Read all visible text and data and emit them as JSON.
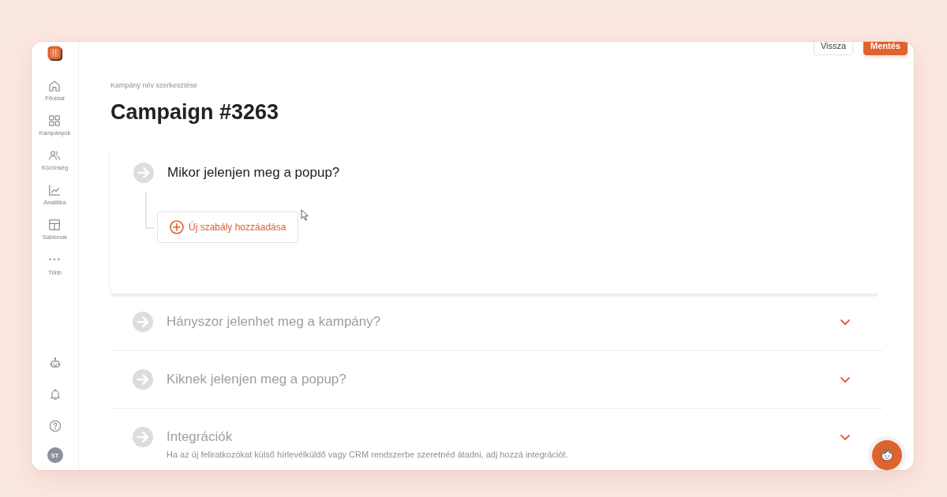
{
  "sidebar": {
    "items": [
      {
        "label": "Főoldal"
      },
      {
        "label": "Kampányok"
      },
      {
        "label": "Közönség"
      },
      {
        "label": "Analitika"
      },
      {
        "label": "Sablonok"
      },
      {
        "label": "Több"
      }
    ],
    "user": {
      "initials": "ST"
    }
  },
  "header": {
    "buttons": [
      {
        "label": "Vissza",
        "kind": "outline"
      },
      {
        "label": "Mentés",
        "kind": "filled"
      }
    ]
  },
  "breadcrumb": "Kampány név szerkesztése",
  "title": "Campaign #3263",
  "sections": [
    {
      "title": "Mikor jelenjen meg a popup?",
      "expanded": true,
      "add_rule_button": "Új szabály hozzáadása"
    },
    {
      "title": "Hányszor jelenhet meg a kampány?",
      "expanded": false
    },
    {
      "title": "Kiknek jelenjen meg a popup?",
      "expanded": false
    },
    {
      "title": "Integrációk",
      "expanded": false,
      "description": "Ha az új feliratkozókat külső hírlevélküldő vagy CRM rendszerbe szeretnéd átadni, adj hozzá integrációt."
    }
  ]
}
